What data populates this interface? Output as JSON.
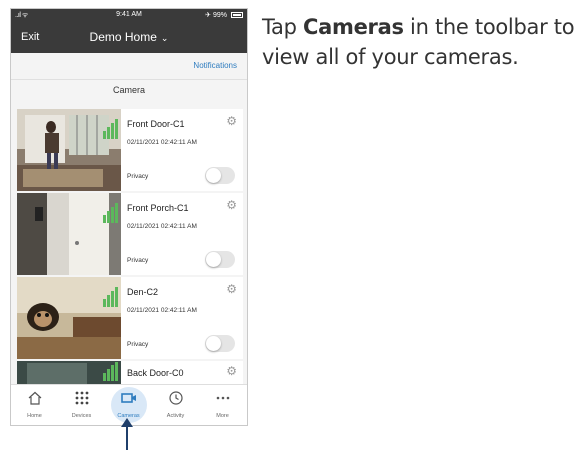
{
  "status_bar": {
    "signal": "..ıl ᯤ",
    "time": "9:41 AM",
    "battery": "✈ 99%"
  },
  "header": {
    "exit_label": "Exit",
    "home_title": "Demo Home",
    "chevron": "⌄"
  },
  "notifications_label": "Notifications",
  "section_title": "Camera",
  "cameras": [
    {
      "name": "Front Door-C1",
      "timestamp": "02/11/2021 02:42:11 AM",
      "privacy_label": "Privacy",
      "privacy_on": false
    },
    {
      "name": "Front Porch-C1",
      "timestamp": "02/11/2021 02:42:11 AM",
      "privacy_label": "Privacy",
      "privacy_on": false
    },
    {
      "name": "Den-C2",
      "timestamp": "02/11/2021 02:42:11 AM",
      "privacy_label": "Privacy",
      "privacy_on": false
    },
    {
      "name": "Back Door-C0"
    }
  ],
  "tabs": [
    {
      "label": "Home",
      "icon": "home-icon"
    },
    {
      "label": "Devices",
      "icon": "grid-icon"
    },
    {
      "label": "Cameras",
      "icon": "camera-icon",
      "active": true
    },
    {
      "label": "Activity",
      "icon": "clock-icon"
    },
    {
      "label": "More",
      "icon": "more-icon"
    }
  ],
  "instruction": {
    "before": "Tap ",
    "bold": "Cameras",
    "after": " in the toolbar to view all of your cameras."
  },
  "colors": {
    "header_bg": "#3a3a3a",
    "accent": "#2e7cbf",
    "arrow": "#1f3f6b"
  }
}
